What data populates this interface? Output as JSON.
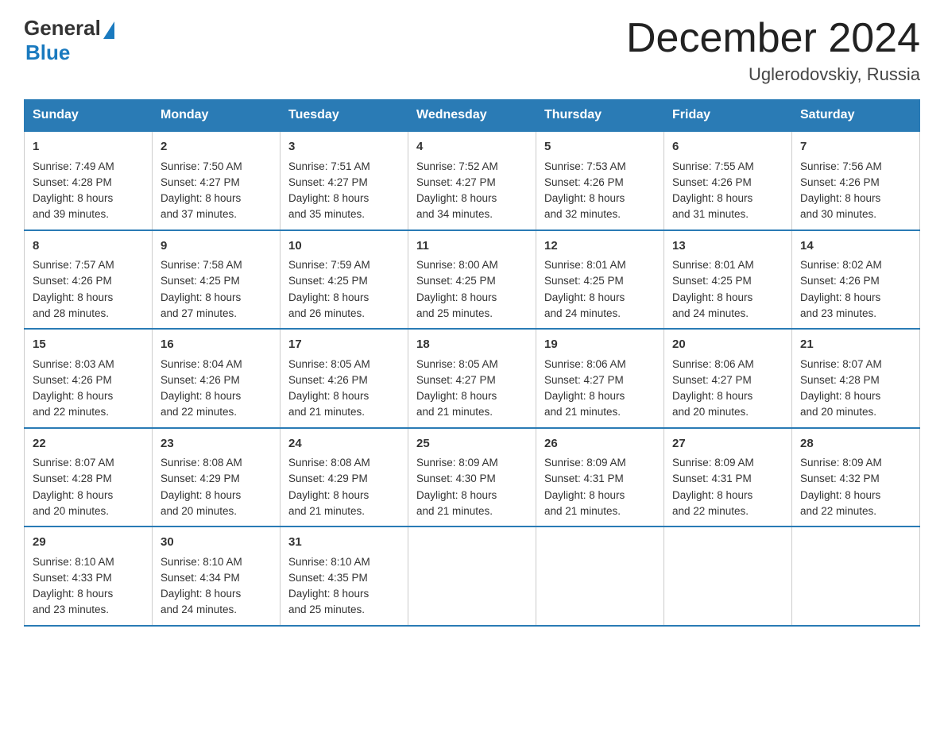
{
  "header": {
    "logo_general": "General",
    "logo_blue": "Blue",
    "title": "December 2024",
    "location": "Uglerodovskiy, Russia"
  },
  "days_of_week": [
    "Sunday",
    "Monday",
    "Tuesday",
    "Wednesday",
    "Thursday",
    "Friday",
    "Saturday"
  ],
  "weeks": [
    [
      {
        "day": "1",
        "sunrise": "7:49 AM",
        "sunset": "4:28 PM",
        "daylight_hours": "8",
        "daylight_minutes": "39"
      },
      {
        "day": "2",
        "sunrise": "7:50 AM",
        "sunset": "4:27 PM",
        "daylight_hours": "8",
        "daylight_minutes": "37"
      },
      {
        "day": "3",
        "sunrise": "7:51 AM",
        "sunset": "4:27 PM",
        "daylight_hours": "8",
        "daylight_minutes": "35"
      },
      {
        "day": "4",
        "sunrise": "7:52 AM",
        "sunset": "4:27 PM",
        "daylight_hours": "8",
        "daylight_minutes": "34"
      },
      {
        "day": "5",
        "sunrise": "7:53 AM",
        "sunset": "4:26 PM",
        "daylight_hours": "8",
        "daylight_minutes": "32"
      },
      {
        "day": "6",
        "sunrise": "7:55 AM",
        "sunset": "4:26 PM",
        "daylight_hours": "8",
        "daylight_minutes": "31"
      },
      {
        "day": "7",
        "sunrise": "7:56 AM",
        "sunset": "4:26 PM",
        "daylight_hours": "8",
        "daylight_minutes": "30"
      }
    ],
    [
      {
        "day": "8",
        "sunrise": "7:57 AM",
        "sunset": "4:26 PM",
        "daylight_hours": "8",
        "daylight_minutes": "28"
      },
      {
        "day": "9",
        "sunrise": "7:58 AM",
        "sunset": "4:25 PM",
        "daylight_hours": "8",
        "daylight_minutes": "27"
      },
      {
        "day": "10",
        "sunrise": "7:59 AM",
        "sunset": "4:25 PM",
        "daylight_hours": "8",
        "daylight_minutes": "26"
      },
      {
        "day": "11",
        "sunrise": "8:00 AM",
        "sunset": "4:25 PM",
        "daylight_hours": "8",
        "daylight_minutes": "25"
      },
      {
        "day": "12",
        "sunrise": "8:01 AM",
        "sunset": "4:25 PM",
        "daylight_hours": "8",
        "daylight_minutes": "24"
      },
      {
        "day": "13",
        "sunrise": "8:01 AM",
        "sunset": "4:25 PM",
        "daylight_hours": "8",
        "daylight_minutes": "24"
      },
      {
        "day": "14",
        "sunrise": "8:02 AM",
        "sunset": "4:26 PM",
        "daylight_hours": "8",
        "daylight_minutes": "23"
      }
    ],
    [
      {
        "day": "15",
        "sunrise": "8:03 AM",
        "sunset": "4:26 PM",
        "daylight_hours": "8",
        "daylight_minutes": "22"
      },
      {
        "day": "16",
        "sunrise": "8:04 AM",
        "sunset": "4:26 PM",
        "daylight_hours": "8",
        "daylight_minutes": "22"
      },
      {
        "day": "17",
        "sunrise": "8:05 AM",
        "sunset": "4:26 PM",
        "daylight_hours": "8",
        "daylight_minutes": "21"
      },
      {
        "day": "18",
        "sunrise": "8:05 AM",
        "sunset": "4:27 PM",
        "daylight_hours": "8",
        "daylight_minutes": "21"
      },
      {
        "day": "19",
        "sunrise": "8:06 AM",
        "sunset": "4:27 PM",
        "daylight_hours": "8",
        "daylight_minutes": "21"
      },
      {
        "day": "20",
        "sunrise": "8:06 AM",
        "sunset": "4:27 PM",
        "daylight_hours": "8",
        "daylight_minutes": "20"
      },
      {
        "day": "21",
        "sunrise": "8:07 AM",
        "sunset": "4:28 PM",
        "daylight_hours": "8",
        "daylight_minutes": "20"
      }
    ],
    [
      {
        "day": "22",
        "sunrise": "8:07 AM",
        "sunset": "4:28 PM",
        "daylight_hours": "8",
        "daylight_minutes": "20"
      },
      {
        "day": "23",
        "sunrise": "8:08 AM",
        "sunset": "4:29 PM",
        "daylight_hours": "8",
        "daylight_minutes": "20"
      },
      {
        "day": "24",
        "sunrise": "8:08 AM",
        "sunset": "4:29 PM",
        "daylight_hours": "8",
        "daylight_minutes": "21"
      },
      {
        "day": "25",
        "sunrise": "8:09 AM",
        "sunset": "4:30 PM",
        "daylight_hours": "8",
        "daylight_minutes": "21"
      },
      {
        "day": "26",
        "sunrise": "8:09 AM",
        "sunset": "4:31 PM",
        "daylight_hours": "8",
        "daylight_minutes": "21"
      },
      {
        "day": "27",
        "sunrise": "8:09 AM",
        "sunset": "4:31 PM",
        "daylight_hours": "8",
        "daylight_minutes": "22"
      },
      {
        "day": "28",
        "sunrise": "8:09 AM",
        "sunset": "4:32 PM",
        "daylight_hours": "8",
        "daylight_minutes": "22"
      }
    ],
    [
      {
        "day": "29",
        "sunrise": "8:10 AM",
        "sunset": "4:33 PM",
        "daylight_hours": "8",
        "daylight_minutes": "23"
      },
      {
        "day": "30",
        "sunrise": "8:10 AM",
        "sunset": "4:34 PM",
        "daylight_hours": "8",
        "daylight_minutes": "24"
      },
      {
        "day": "31",
        "sunrise": "8:10 AM",
        "sunset": "4:35 PM",
        "daylight_hours": "8",
        "daylight_minutes": "25"
      },
      null,
      null,
      null,
      null
    ]
  ],
  "labels": {
    "sunrise": "Sunrise:",
    "sunset": "Sunset:",
    "daylight": "Daylight:",
    "hours_suffix": "hours",
    "and": "and",
    "minutes_suffix": "minutes."
  }
}
